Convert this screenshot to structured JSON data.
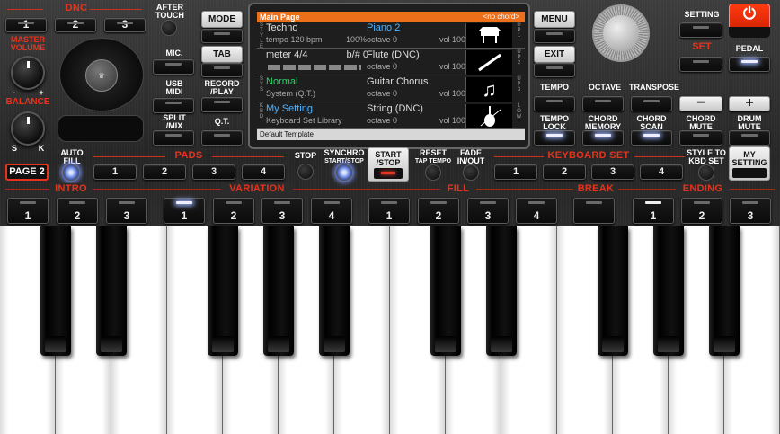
{
  "dnc": {
    "title": "DNC",
    "buttons": [
      "1",
      "2",
      "3"
    ]
  },
  "left": {
    "master_volume": "MASTER\nVOLUME",
    "balance": "BALANCE",
    "minus": "-",
    "plus": "+",
    "s": "S",
    "k": "K"
  },
  "labels": {
    "after_touch": "AFTER\nTOUCH",
    "mic": "MIC.",
    "usb_midi": "USB\nMIDI",
    "split_mix": "SPLIT\n/MIX",
    "record_play": "RECORD\n/PLAY",
    "qt": "Q.T.",
    "mode": "MODE",
    "tab": "TAB"
  },
  "screen": {
    "title": "Main Page",
    "chord": "<no chord>",
    "rows": [
      {
        "side": "S\nT\nY\nL\nE",
        "l1": "Techno",
        "l2a": "tempo 120 bpm",
        "l2b": "100%",
        "m1": "Piano 2",
        "m2a": "octave 0",
        "m2b": "vol 100",
        "r": "U\nP\n1"
      },
      {
        "side": "",
        "l1": "meter 4/4",
        "l1b": "b/# 0",
        "m1": "Flute (DNC)",
        "m2a": "octave 0",
        "m2b": "vol 100",
        "r": "U\nP\n2"
      },
      {
        "side": "S\nY\nS",
        "l1": "Normal",
        "l2a": "System (Q.T.)",
        "m1": "Guitar Chorus",
        "m2a": "octave 0",
        "m2b": "vol 100",
        "r": "U\nP\n3"
      },
      {
        "side": "K\nB\nD",
        "l1": "My Setting",
        "l2a": "Keyboard Set Library",
        "m1": "String (DNC)",
        "m2a": "octave 0",
        "m2b": "vol 100",
        "r": "L\nO\nW"
      }
    ],
    "footer": "Default Template"
  },
  "right": {
    "menu": "MENU",
    "exit": "EXIT",
    "setting": "SETTING",
    "set": "SET",
    "pedal": "PEDAL",
    "tempo": "TEMPO",
    "octave": "OCTAVE",
    "transpose": "TRANSPOSE",
    "minus": "−",
    "plus": "+",
    "tempo_lock": "TEMPO\nLOCK",
    "chord_memory": "CHORD\nMEMORY",
    "chord_scan": "CHORD\nSCAN",
    "chord_mute": "CHORD\nMUTE",
    "drum_mute": "DRUM\nMUTE",
    "power": "⏻"
  },
  "mid": {
    "page": "PAGE 2",
    "auto_fill": "AUTO\nFILL",
    "pads": "PADS",
    "pad_buttons": [
      "1",
      "2",
      "3",
      "4"
    ],
    "stop": "STOP",
    "synchro": "SYNCHRO",
    "synchro_sub": "START/STOP",
    "start_stop": "START\n/STOP",
    "reset": "RESET",
    "reset_sub": "TAP TEMPO",
    "fade": "FADE\nIN/OUT",
    "keyboard_set": "KEYBOARD SET",
    "kbd_buttons": [
      "1",
      "2",
      "3",
      "4"
    ],
    "style_to_kbd": "STYLE TO\nKBD SET",
    "my_setting": "MY\nSETTING"
  },
  "sections": {
    "intro": "INTRO",
    "variation": "VARIATION",
    "fill": "FILL",
    "break": "BREAK",
    "ending": "ENDING"
  },
  "bottom_buttons": [
    "1",
    "2",
    "3",
    "1",
    "2",
    "3",
    "4",
    "1",
    "2",
    "3",
    "4",
    "",
    "1",
    "2",
    "3"
  ],
  "colors": {
    "accent": "#e8331c",
    "screen_header": "#ee6f1a",
    "led": "#9ab4ff"
  }
}
